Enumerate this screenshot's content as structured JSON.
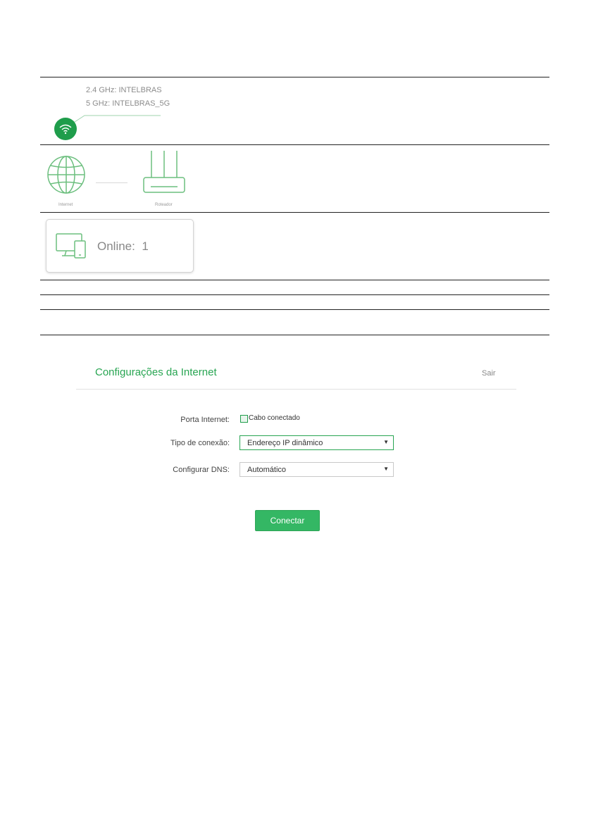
{
  "wifi": {
    "ssid_24": "2.4 GHz: INTELBRAS",
    "ssid_5": "5 GHz: INTELBRAS_5G"
  },
  "topology": {
    "internet_label": "Internet",
    "router_label": "Roteador"
  },
  "clients": {
    "online_label": "Online:",
    "online_count": "1"
  },
  "panel": {
    "title": "Configurações da Internet",
    "logout_label": "Sair"
  },
  "form": {
    "port_label": "Porta Internet:",
    "port_status": "Cabo conectado",
    "connection_type_label": "Tipo de conexão:",
    "connection_type_value": "Endereço IP dinâmico",
    "dns_label": "Configurar DNS:",
    "dns_value": "Automático",
    "connect_button": "Conectar"
  },
  "colors": {
    "accent": "#28a552",
    "button": "#34b764"
  },
  "icons": [
    "wifi-icon",
    "globe-icon",
    "router-icon",
    "devices-icon",
    "chevron-down-icon"
  ]
}
